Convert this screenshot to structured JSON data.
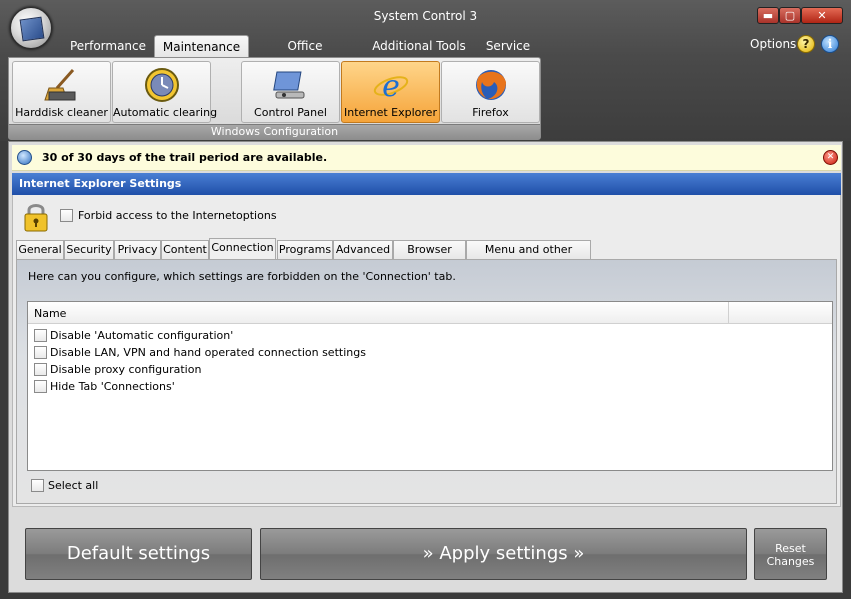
{
  "window": {
    "title": "System Control 3",
    "controls": {
      "minimize": "▬",
      "maximize": "▢",
      "close": "✕"
    }
  },
  "ribbon_tabs": [
    {
      "label": "Performance",
      "active": false
    },
    {
      "label": "Maintenance",
      "active": true
    },
    {
      "label": "Office functions",
      "active": false
    },
    {
      "label": "Additional Tools",
      "active": false
    },
    {
      "label": "Service",
      "active": false
    }
  ],
  "header_right": {
    "options": "Options",
    "help": "?",
    "info": "i"
  },
  "ribbon": {
    "buttons": [
      {
        "label": "Harddisk cleaner",
        "icon": "broom-icon",
        "active": false
      },
      {
        "label": "Automatic clearing",
        "icon": "clock-icon",
        "active": false
      },
      {
        "label": "Control Panel",
        "icon": "control-panel-icon",
        "active": false
      },
      {
        "label": "Internet Explorer",
        "icon": "internet-explorer-icon",
        "active": true
      },
      {
        "label": "Firefox",
        "icon": "firefox-icon",
        "active": false
      }
    ],
    "group_label": "Windows Configuration"
  },
  "notice": {
    "text": "30 of 30 days of the trail period are available."
  },
  "section": {
    "title": "Internet Explorer Settings"
  },
  "forbid": {
    "label": "Forbid  access to the Internetoptions",
    "checked": false
  },
  "sub_tabs": [
    {
      "label": "General",
      "active": false
    },
    {
      "label": "Security",
      "active": false
    },
    {
      "label": "Privacy",
      "active": false
    },
    {
      "label": "Content",
      "active": false
    },
    {
      "label": "Connection",
      "active": true
    },
    {
      "label": "Programs",
      "active": false
    },
    {
      "label": "Advanced",
      "active": false
    },
    {
      "label": "Browser Title",
      "active": false
    },
    {
      "label": "Menu and other Settings",
      "active": false
    }
  ],
  "connection_tab": {
    "description": "Here can you configure, which settings are forbidden on the 'Connection' tab.",
    "columns": [
      "Name",
      ""
    ],
    "items": [
      {
        "label": "Disable 'Automatic configuration'",
        "checked": false
      },
      {
        "label": "Disable LAN, VPN and hand operated connection settings",
        "checked": false
      },
      {
        "label": "Disable proxy configuration",
        "checked": false
      },
      {
        "label": "Hide Tab 'Connections'",
        "checked": false
      }
    ],
    "select_all": "Select all"
  },
  "actions": {
    "default": "Default settings",
    "apply": "» Apply settings »",
    "reset_line1": "Reset",
    "reset_line2": "Changes"
  }
}
